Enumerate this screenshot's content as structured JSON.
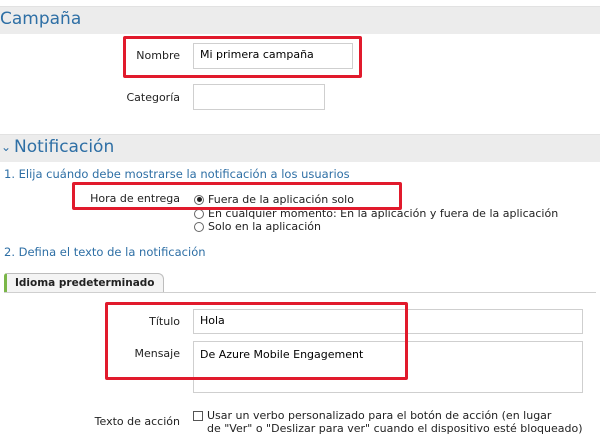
{
  "campaign": {
    "title": "Campaña",
    "name_label": "Nombre",
    "name_value": "Mi primera campaña",
    "category_label": "Categoría",
    "category_value": ""
  },
  "notification": {
    "title": "Notificación",
    "step1": "1. Elija cuándo debe mostrarse la notificación a los usuarios",
    "delivery_label": "Hora de entrega",
    "delivery_options": [
      {
        "label": "Fuera de la aplicación solo",
        "selected": true
      },
      {
        "label": "En cualquier momento: En la aplicación y fuera de la aplicación",
        "selected": false
      },
      {
        "label": "Solo en la aplicación",
        "selected": false
      }
    ],
    "step2": "2. Defina el texto de la notificación",
    "tab_label": "Idioma predeterminado",
    "title_label": "Título",
    "title_value": "Hola",
    "message_label": "Mensaje",
    "message_value": "De Azure Mobile Engagement",
    "action_label": "Texto de acción",
    "action_checkbox_line1": "Usar un verbo personalizado para el botón de acción (en lugar",
    "action_checkbox_line2": "de \"Ver\" o \"Deslizar para ver\" cuando el dispositivo esté bloqueado)",
    "action_checked": false
  },
  "colors": {
    "accent": "#2e6fa5",
    "highlight": "#e11a2c",
    "tab_accent": "#7ab648"
  }
}
